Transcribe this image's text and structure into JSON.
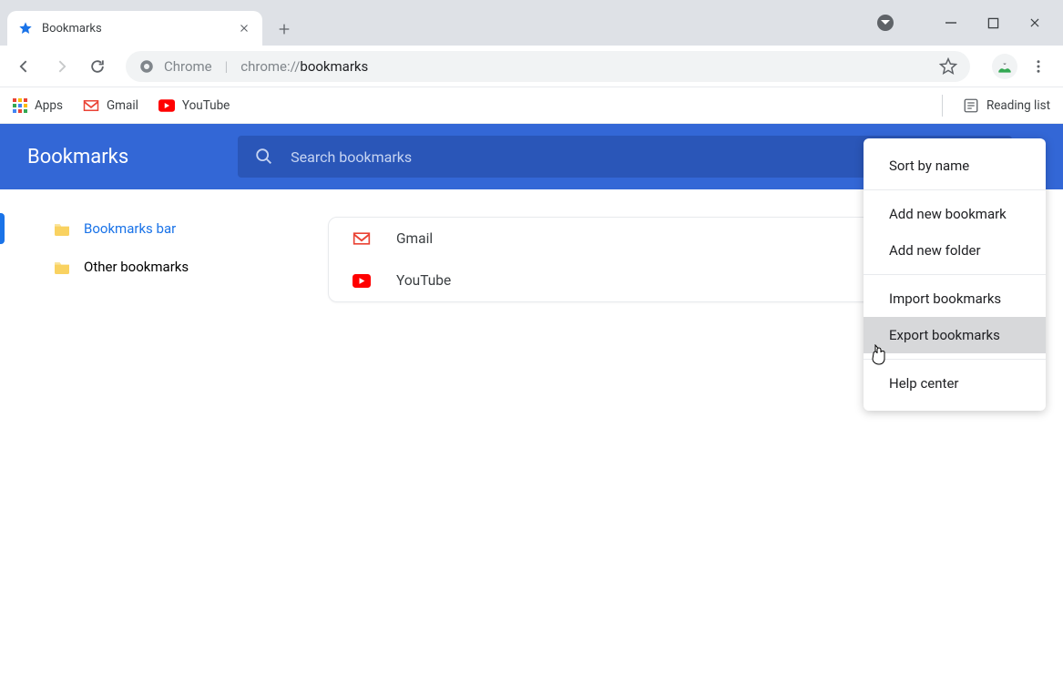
{
  "tab": {
    "title": "Bookmarks"
  },
  "toolbar": {
    "url_prefix": "Chrome",
    "url_path_pre": "chrome://",
    "url_path_bold": "bookmarks"
  },
  "bookmarks_bar": {
    "apps": "Apps",
    "gmail": "Gmail",
    "youtube": "YouTube",
    "reading_list": "Reading list"
  },
  "app": {
    "title": "Bookmarks",
    "search_placeholder": "Search bookmarks"
  },
  "sidebar": {
    "items": [
      {
        "label": "Bookmarks bar",
        "selected": true
      },
      {
        "label": "Other bookmarks",
        "selected": false
      }
    ]
  },
  "bookmarks": [
    {
      "label": "Gmail",
      "icon": "gmail-icon"
    },
    {
      "label": "YouTube",
      "icon": "youtube-icon"
    }
  ],
  "context_menu": {
    "sort": "Sort by name",
    "add_bookmark": "Add new bookmark",
    "add_folder": "Add new folder",
    "import": "Import bookmarks",
    "export": "Export bookmarks",
    "help": "Help center"
  }
}
